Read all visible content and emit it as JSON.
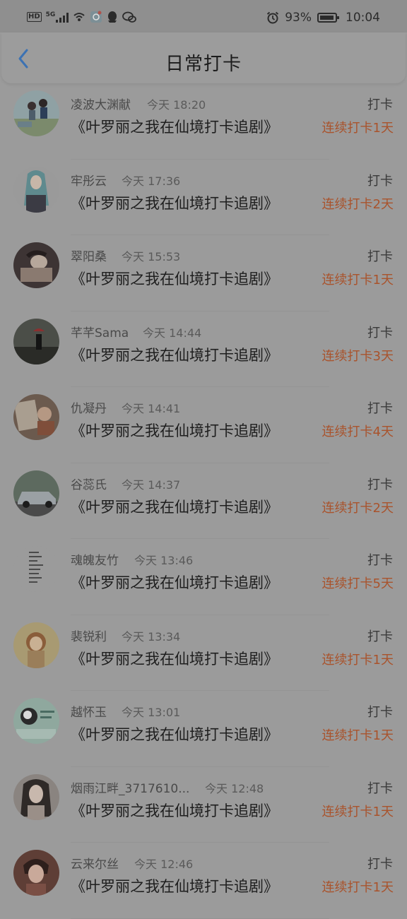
{
  "status_bar": {
    "network_label": "HD",
    "network_gen": "5G",
    "battery": "93%",
    "time": "10:04",
    "icons": [
      "hd-icon",
      "5g-signal-icon",
      "wifi-icon",
      "carrier-app-icon",
      "qq-icon",
      "wechat-icon",
      "alarm-icon",
      "battery-icon"
    ]
  },
  "header": {
    "title": "日常打卡",
    "back_icon": "chevron-left-icon",
    "back_color": "#3c72b3"
  },
  "colors": {
    "streak": "#a9532c",
    "text_primary": "#1e1e1e",
    "background": "#9b9b9b"
  },
  "entries": [
    {
      "username": "凌波大渊献",
      "time": "今天 18:20",
      "title": "《叶罗丽之我在仙境打卡追剧》",
      "action": "打卡",
      "streak": "连续打卡1天",
      "avatar": "avatar-1"
    },
    {
      "username": "牢彤云",
      "time": "今天 17:36",
      "title": "《叶罗丽之我在仙境打卡追剧》",
      "action": "打卡",
      "streak": "连续打卡2天",
      "avatar": "avatar-2"
    },
    {
      "username": "翠阳桑",
      "time": "今天 15:53",
      "title": "《叶罗丽之我在仙境打卡追剧》",
      "action": "打卡",
      "streak": "连续打卡1天",
      "avatar": "avatar-3"
    },
    {
      "username": "芊芊Sama",
      "time": "今天 14:44",
      "title": "《叶罗丽之我在仙境打卡追剧》",
      "action": "打卡",
      "streak": "连续打卡3天",
      "avatar": "avatar-4"
    },
    {
      "username": "仇凝丹",
      "time": "今天 14:41",
      "title": "《叶罗丽之我在仙境打卡追剧》",
      "action": "打卡",
      "streak": "连续打卡4天",
      "avatar": "avatar-5"
    },
    {
      "username": "谷蕊氏",
      "time": "今天 14:37",
      "title": "《叶罗丽之我在仙境打卡追剧》",
      "action": "打卡",
      "streak": "连续打卡2天",
      "avatar": "avatar-6"
    },
    {
      "username": "魂魄友竹",
      "time": "今天 13:46",
      "title": "《叶罗丽之我在仙境打卡追剧》",
      "action": "打卡",
      "streak": "连续打卡5天",
      "avatar": "avatar-7"
    },
    {
      "username": "裴锐利",
      "time": "今天 13:34",
      "title": "《叶罗丽之我在仙境打卡追剧》",
      "action": "打卡",
      "streak": "连续打卡1天",
      "avatar": "avatar-8"
    },
    {
      "username": "越怀玉",
      "time": "今天 13:01",
      "title": "《叶罗丽之我在仙境打卡追剧》",
      "action": "打卡",
      "streak": "连续打卡1天",
      "avatar": "avatar-9"
    },
    {
      "username": "烟雨江畔_3717610...",
      "time": "今天 12:48",
      "title": "《叶罗丽之我在仙境打卡追剧》",
      "action": "打卡",
      "streak": "连续打卡1天",
      "avatar": "avatar-10"
    },
    {
      "username": "云来尔丝",
      "time": "今天 12:46",
      "title": "《叶罗丽之我在仙境打卡追剧》",
      "action": "打卡",
      "streak": "连续打卡1天",
      "avatar": "avatar-11"
    }
  ]
}
